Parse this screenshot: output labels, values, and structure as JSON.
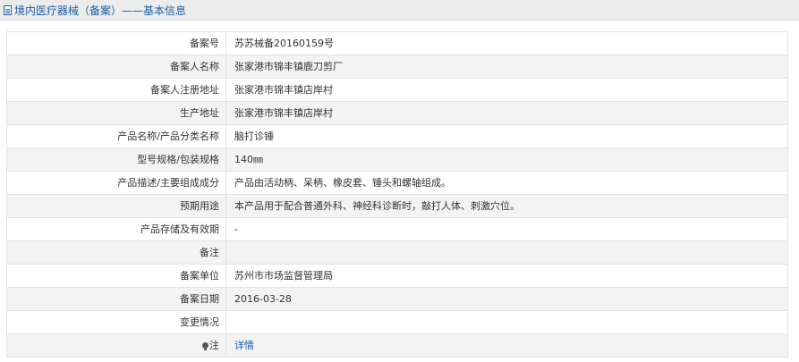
{
  "header": {
    "icon": "document-icon",
    "title": "境内医疗器械（备案）——基本信息"
  },
  "rows": [
    {
      "label": "备案号",
      "value": "苏苏械备20160159号"
    },
    {
      "label": "备案人名称",
      "value": "张家港市锦丰镇鹿刀剪厂"
    },
    {
      "label": "备案人注册地址",
      "value": "张家港市锦丰镇店岸村"
    },
    {
      "label": "生产地址",
      "value": "张家港市锦丰镇店岸村"
    },
    {
      "label": "产品名称/产品分类名称",
      "value": "脑打诊锤"
    },
    {
      "label": "型号规格/包装规格",
      "value": "140㎜"
    },
    {
      "label": "产品描述/主要组成成分",
      "value": "产品由活动柄、呆柄、橡皮套、锤头和螺轴组成。"
    },
    {
      "label": "预期用途",
      "value": "本产品用于配合普通外科、神经科诊断时，敲打人体、刺激穴位。"
    },
    {
      "label": "产品存储及有效期",
      "value": "-"
    },
    {
      "label": "备注",
      "value": ""
    },
    {
      "label": "备案单位",
      "value": "苏州市市场监督管理局"
    },
    {
      "label": "备案日期",
      "value": "2016-03-28"
    },
    {
      "label": "变更情况",
      "value": ""
    }
  ],
  "note": {
    "icon": "lightbulb-icon",
    "label": "注",
    "link_text": "详情"
  }
}
